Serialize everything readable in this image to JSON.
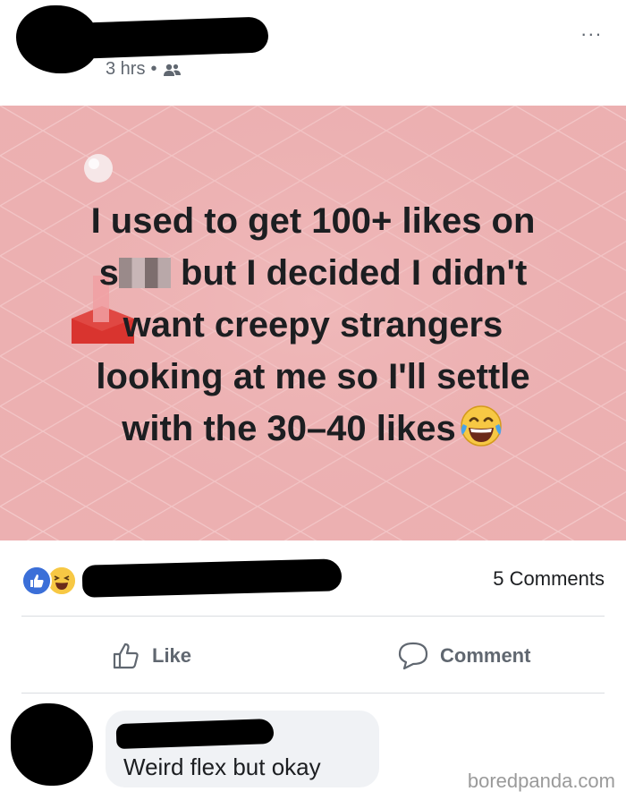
{
  "header": {
    "time": "3 hrs",
    "separator": "•",
    "audience_icon": "friends-icon",
    "more_icon": "more-dots-icon",
    "more_label": "..."
  },
  "post": {
    "line1": "I used to get 100+ likes on",
    "line2_prefix": "s",
    "line2_suffix": "but I decided I didn't",
    "line3": "want creepy strangers",
    "line4": "looking at me so I'll settle",
    "line5": "with the 30–40 likes",
    "emoji": "laughing-tears-emoji",
    "background_color": "#ecb0b1"
  },
  "reactions": {
    "icons": [
      "like-icon",
      "haha-icon"
    ],
    "comments": "5 Comments"
  },
  "actions": {
    "like_label": "Like",
    "comment_label": "Comment"
  },
  "comment": {
    "text": "Weird flex but okay"
  },
  "watermark": "boredpanda.com",
  "colors": {
    "like_blue": "#3b6fd8",
    "haha_yellow": "#f7c844",
    "meta_gray": "#606770"
  }
}
